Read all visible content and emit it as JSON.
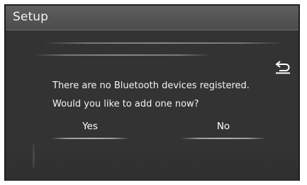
{
  "header": {
    "title": "Setup"
  },
  "dialog": {
    "message_line1": "There are no Bluetooth devices registered.",
    "message_line2": "Would you like to add one now?",
    "yes_label": "Yes",
    "no_label": "No"
  },
  "icons": {
    "back": "back-arrow-icon"
  },
  "colors": {
    "background": "#333333",
    "header": "#555555",
    "text": "#ffffff",
    "frame": "#1e1e1e"
  }
}
